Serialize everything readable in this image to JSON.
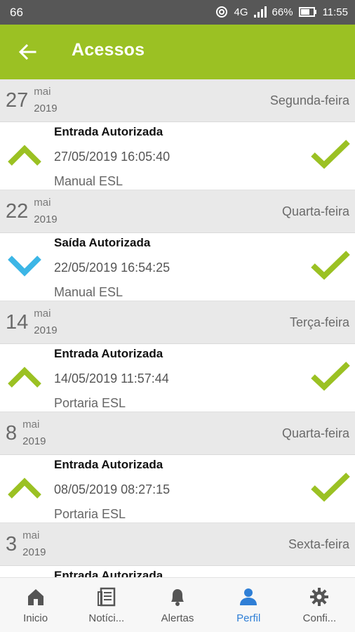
{
  "status_bar": {
    "left_text": "66",
    "network": "4G",
    "battery": "66%",
    "time": "11:55"
  },
  "app_bar": {
    "title": "Acessos",
    "back_icon": "arrow-left-icon"
  },
  "colors": {
    "accent": "#9bc123",
    "entry_arrow_up": "#9bc123",
    "exit_arrow_down": "#3cb6e6",
    "check": "#9bc123",
    "active_tab": "#2f7fd6"
  },
  "days": [
    {
      "day": "27",
      "month": "mai",
      "year": "2019",
      "weekday": "Segunda-feira",
      "entries": [
        {
          "type": "in",
          "title": "Entrada Autorizada",
          "datetime": "27/05/2019 16:05:40",
          "location": "Manual ESL"
        }
      ]
    },
    {
      "day": "22",
      "month": "mai",
      "year": "2019",
      "weekday": "Quarta-feira",
      "entries": [
        {
          "type": "out",
          "title": "Saída Autorizada",
          "datetime": "22/05/2019 16:54:25",
          "location": "Manual ESL"
        }
      ]
    },
    {
      "day": "14",
      "month": "mai",
      "year": "2019",
      "weekday": "Terça-feira",
      "entries": [
        {
          "type": "in",
          "title": "Entrada Autorizada",
          "datetime": "14/05/2019 11:57:44",
          "location": "Portaria ESL"
        }
      ]
    },
    {
      "day": "8",
      "month": "mai",
      "year": "2019",
      "weekday": "Quarta-feira",
      "entries": [
        {
          "type": "in",
          "title": "Entrada Autorizada",
          "datetime": "08/05/2019 08:27:15",
          "location": "Portaria ESL"
        }
      ]
    },
    {
      "day": "3",
      "month": "mai",
      "year": "2019",
      "weekday": "Sexta-feira",
      "entries": [
        {
          "type": "in",
          "title": "Entrada Autorizada",
          "datetime": "",
          "location": ""
        }
      ]
    }
  ],
  "tabs": [
    {
      "label": "Inicio",
      "icon": "home-icon",
      "active": false
    },
    {
      "label": "Notíci...",
      "icon": "newspaper-icon",
      "active": false
    },
    {
      "label": "Alertas",
      "icon": "bell-icon",
      "active": false
    },
    {
      "label": "Perfil",
      "icon": "person-icon",
      "active": true
    },
    {
      "label": "Confi...",
      "icon": "gear-icon",
      "active": false
    }
  ]
}
